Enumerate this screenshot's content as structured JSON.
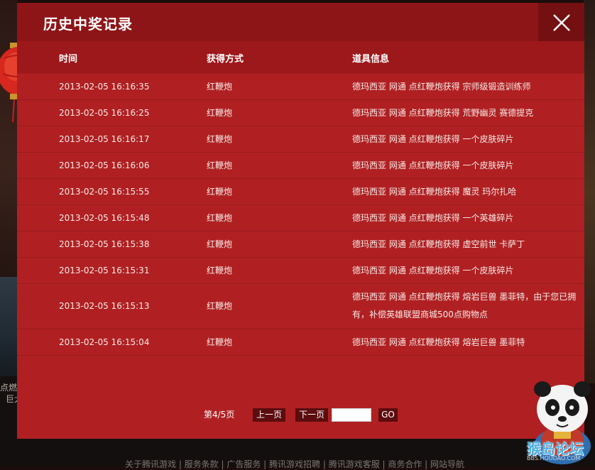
{
  "modal": {
    "title": "历史中奖记录",
    "columns": [
      "时间",
      "获得方式",
      "道具信息"
    ],
    "rows": [
      {
        "time": "2013-02-05 16:16:35",
        "method": "红鞭炮",
        "item": "德玛西亚 网通 点红鞭炮获得 宗师级锻造训练师"
      },
      {
        "time": "2013-02-05 16:16:25",
        "method": "红鞭炮",
        "item": "德玛西亚 网通 点红鞭炮获得 荒野幽灵 赛德提克"
      },
      {
        "time": "2013-02-05 16:16:17",
        "method": "红鞭炮",
        "item": "德玛西亚 网通 点红鞭炮获得 一个皮肤碎片"
      },
      {
        "time": "2013-02-05 16:16:06",
        "method": "红鞭炮",
        "item": "德玛西亚 网通 点红鞭炮获得 一个皮肤碎片"
      },
      {
        "time": "2013-02-05 16:15:55",
        "method": "红鞭炮",
        "item": "德玛西亚 网通 点红鞭炮获得 魔灵 玛尔扎哈"
      },
      {
        "time": "2013-02-05 16:15:48",
        "method": "红鞭炮",
        "item": "德玛西亚 网通 点红鞭炮获得 一个英雄碎片"
      },
      {
        "time": "2013-02-05 16:15:38",
        "method": "红鞭炮",
        "item": "德玛西亚 网通 点红鞭炮获得 虚空前世 卡萨丁"
      },
      {
        "time": "2013-02-05 16:15:31",
        "method": "红鞭炮",
        "item": "德玛西亚 网通 点红鞭炮获得 一个皮肤碎片"
      },
      {
        "time": "2013-02-05 16:15:13",
        "method": "红鞭炮",
        "item": "德玛西亚 网通 点红鞭炮获得 熔岩巨兽 墨菲特，由于您已拥有，补偿英雄联盟商城500点购物点"
      },
      {
        "time": "2013-02-05 16:15:04",
        "method": "红鞭炮",
        "item": "德玛西亚 网通 点红鞭炮获得 熔岩巨兽 墨菲特"
      }
    ],
    "pager": {
      "page_info": "第4/5页",
      "prev_label": "上一页",
      "next_label": "下一页",
      "page_input_value": "",
      "go_label": "GO"
    }
  },
  "background": {
    "left_text": "点燃\n巨大",
    "footer_text": "关于腾讯游戏 | 服务条款 | 广告服务 | 腾讯游戏招聘 | 腾讯游戏客服 | 商务合作 | 网站导航"
  },
  "watermark": {
    "text": "猴岛论坛",
    "sub": "BBS.HOUDAO.COM"
  },
  "colors": {
    "modal_bg": "#b02022",
    "header_bg": "#8e1517",
    "close_bg": "#741012",
    "button_bg": "#5c0c0e"
  },
  "icons": [
    "close-icon",
    "lantern-icon",
    "panda-mascot-icon"
  ]
}
